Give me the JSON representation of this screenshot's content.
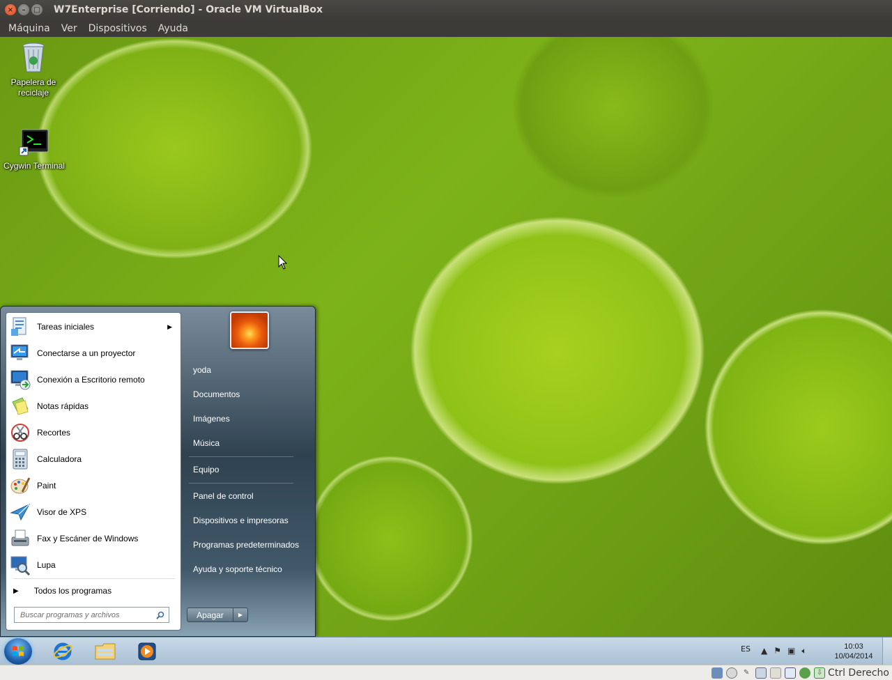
{
  "window": {
    "title": "W7Enterprise [Corriendo] - Oracle VM VirtualBox",
    "menu": [
      "Máquina",
      "Ver",
      "Dispositivos",
      "Ayuda"
    ]
  },
  "desktop": {
    "icons": [
      {
        "label_line1": "Papelera de",
        "label_line2": "reciclaje"
      },
      {
        "label_line1": "Cygwin Terminal"
      }
    ]
  },
  "start_menu": {
    "programs": [
      {
        "label": "Tareas iniciales",
        "icon": "getting-started-icon",
        "has_submenu": true
      },
      {
        "label": "Conectarse a un proyector",
        "icon": "projector-icon"
      },
      {
        "label": "Conexión a Escritorio remoto",
        "icon": "remote-desktop-icon"
      },
      {
        "label": "Notas rápidas",
        "icon": "sticky-notes-icon"
      },
      {
        "label": "Recortes",
        "icon": "snipping-tool-icon"
      },
      {
        "label": "Calculadora",
        "icon": "calculator-icon"
      },
      {
        "label": "Paint",
        "icon": "paint-icon"
      },
      {
        "label": "Visor de XPS",
        "icon": "xps-viewer-icon"
      },
      {
        "label": "Fax y Escáner de Windows",
        "icon": "fax-scan-icon"
      },
      {
        "label": "Lupa",
        "icon": "magnifier-icon"
      }
    ],
    "all_programs": "Todos los programas",
    "search_placeholder": "Buscar programas y archivos",
    "right_links": {
      "user": "yoda",
      "documents": "Documentos",
      "pictures": "Imágenes",
      "music": "Música",
      "computer": "Equipo",
      "control_panel": "Panel de control",
      "devices": "Dispositivos e impresoras",
      "default_programs": "Programas predeterminados",
      "help": "Ayuda y soporte técnico"
    },
    "shutdown_label": "Apagar"
  },
  "taskbar": {
    "language": "ES",
    "time": "10:03",
    "date": "10/04/2014"
  },
  "vbox_status": {
    "host_key": "Ctrl Derecho"
  }
}
